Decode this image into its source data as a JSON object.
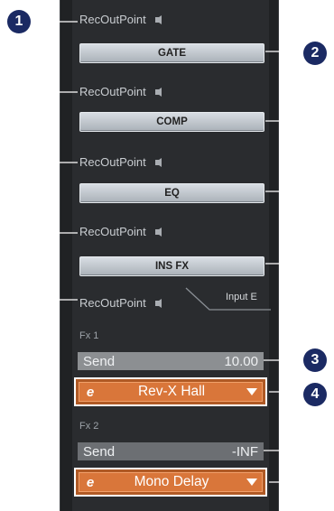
{
  "rec_label": "RecOutPoint",
  "insert_buttons": [
    "GATE",
    "COMP",
    "EQ",
    "INS FX"
  ],
  "input_tab": "Input E",
  "fx1": {
    "label": "Fx 1",
    "send_label": "Send",
    "send_value": "10.00",
    "effect_icon": "e",
    "effect": "Rev-X Hall"
  },
  "fx2": {
    "label": "Fx 2",
    "send_label": "Send",
    "send_value": "-INF",
    "effect_icon": "e",
    "effect": "Mono Delay"
  },
  "badges": [
    "1",
    "2",
    "3",
    "4"
  ],
  "colors": {
    "panel": "#202224",
    "badge": "#1b2a63",
    "effect_orange": "#d9763a",
    "button_gray": "#c6ccd2"
  }
}
